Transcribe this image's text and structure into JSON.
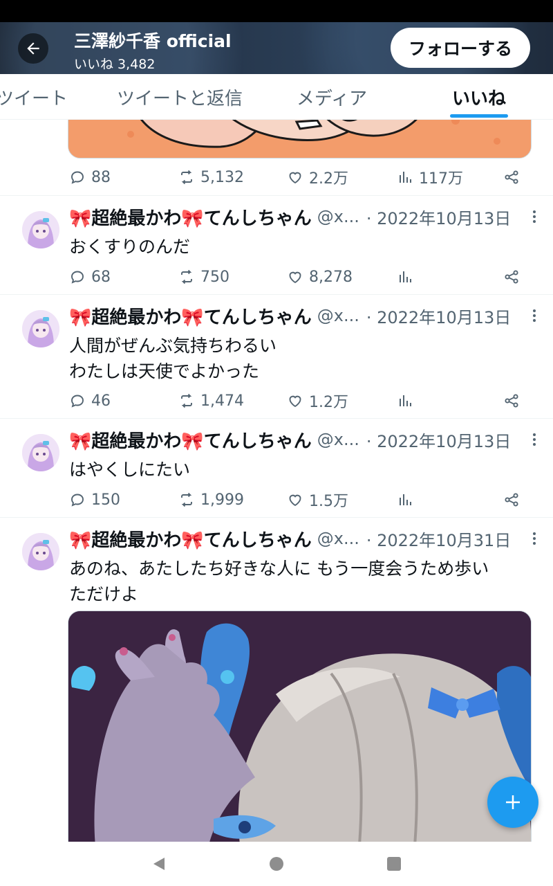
{
  "header": {
    "title": "三澤紗千香 official",
    "subtitle": "いいね 3,482",
    "follow_label": "フォローする"
  },
  "tabs": [
    {
      "label": "ツイート"
    },
    {
      "label": "ツイートと返信"
    },
    {
      "label": "メディア"
    },
    {
      "label": "いいね"
    }
  ],
  "active_tab": "いいね",
  "top_tweet_actions": {
    "reply": "88",
    "retweet": "5,132",
    "like": "2.2万",
    "views": "117万"
  },
  "tweets": [
    {
      "name": "🎀超絶最かわ🎀てんしちゃん",
      "handle": "@x...",
      "date": "· 2022年10月13日",
      "lines": [
        "おくすりのんだ"
      ],
      "reply": "68",
      "retweet": "750",
      "like": "8,278",
      "views": ""
    },
    {
      "name": "🎀超絶最かわ🎀てんしちゃん",
      "handle": "@x...",
      "date": "· 2022年10月13日",
      "lines": [
        "人間がぜんぶ気持ちわるい",
        "わたしは天使でよかった"
      ],
      "reply": "46",
      "retweet": "1,474",
      "like": "1.2万",
      "views": ""
    },
    {
      "name": "🎀超絶最かわ🎀てんしちゃん",
      "handle": "@x...",
      "date": "· 2022年10月13日",
      "lines": [
        "はやくしにたい"
      ],
      "reply": "150",
      "retweet": "1,999",
      "like": "1.5万",
      "views": ""
    },
    {
      "name": "🎀超絶最かわ🎀てんしちゃん",
      "handle": "@x...",
      "date": "· 2022年10月31日",
      "lines": [
        "あのね、あたしたち好きな人に もう一度会うため歩い",
        "ただけよ"
      ]
    }
  ],
  "colors": {
    "accent": "#1d9bf0",
    "text": "#0f1419",
    "muted": "#536471"
  },
  "icons": [
    "back-arrow-icon",
    "reply-icon",
    "retweet-icon",
    "like-icon",
    "views-icon",
    "share-icon",
    "more-icon",
    "compose-plus-icon",
    "nav-back-icon",
    "nav-home-icon",
    "nav-recents-icon"
  ]
}
